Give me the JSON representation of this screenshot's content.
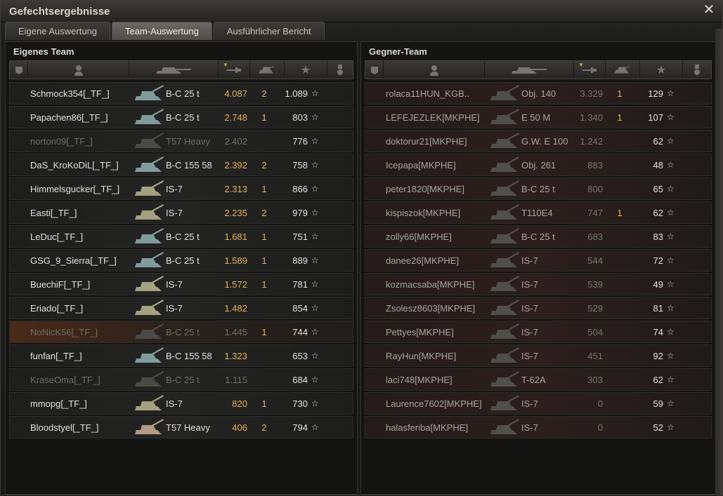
{
  "window": {
    "title": "Gefechtsergebnisse",
    "close_glyph": "✕"
  },
  "tabs": [
    {
      "label": "Eigene Auswertung",
      "active": false
    },
    {
      "label": "Team-Auswertung",
      "active": true
    },
    {
      "label": "Ausführlicher Bericht",
      "active": false
    }
  ],
  "colors": {
    "damage": "#e4b25a",
    "self_row": "#4a2a18",
    "enemy_row": "#2d1f1e",
    "active_tab": "#6a6963"
  },
  "own_team": {
    "title": "Eigenes Team",
    "header_icons": [
      "squad-icon",
      "player-icon",
      "tank-icon",
      "damage-icon",
      "kills-icon",
      "xp-star-icon",
      "medal-icon"
    ],
    "sorted_column": "damage",
    "rows": [
      {
        "player": "Schmock354[_TF_]",
        "vehicle": "B-C 25 t",
        "damage": "4.087",
        "kills": "2",
        "xp": "1.089",
        "alive": true,
        "tank_color": "#7f9c9a"
      },
      {
        "player": "Papachen86[_TF_]",
        "vehicle": "B-C 25 t",
        "damage": "2.748",
        "kills": "1",
        "xp": "803",
        "alive": true,
        "tank_color": "#7f9c9a"
      },
      {
        "player": "norton09[_TF_]",
        "vehicle": "T57 Heavy",
        "damage": "2.402",
        "kills": "",
        "xp": "776",
        "alive": false,
        "tank_color": "#4a4a46"
      },
      {
        "player": "DaS_KroKoDiL[_TF_]",
        "vehicle": "B-C 155 58",
        "damage": "2.392",
        "kills": "2",
        "xp": "758",
        "alive": true,
        "tank_color": "#7f9c9a"
      },
      {
        "player": "Himmelsgucker[_TF_]",
        "vehicle": "IS-7",
        "damage": "2.313",
        "kills": "1",
        "xp": "866",
        "alive": true,
        "tank_color": "#a4a180"
      },
      {
        "player": "Easti[_TF_]",
        "vehicle": "IS-7",
        "damage": "2.235",
        "kills": "2",
        "xp": "979",
        "alive": true,
        "tank_color": "#a4a180"
      },
      {
        "player": "LeDuc[_TF_]",
        "vehicle": "B-C 25 t",
        "damage": "1.681",
        "kills": "1",
        "xp": "751",
        "alive": true,
        "tank_color": "#7f9c9a"
      },
      {
        "player": "GSG_9_Sierra[_TF_]",
        "vehicle": "B-C 25 t",
        "damage": "1.589",
        "kills": "1",
        "xp": "889",
        "alive": true,
        "tank_color": "#7f9c9a"
      },
      {
        "player": "BuechiF[_TF_]",
        "vehicle": "IS-7",
        "damage": "1.572",
        "kills": "1",
        "xp": "781",
        "alive": true,
        "tank_color": "#a4a180"
      },
      {
        "player": "Eriado[_TF_]",
        "vehicle": "IS-7",
        "damage": "1.482",
        "kills": "",
        "xp": "854",
        "alive": true,
        "tank_color": "#a4a180"
      },
      {
        "player": "NoNicK56[_TF_]",
        "vehicle": "B-C 25 t",
        "damage": "1.445",
        "kills": "1",
        "xp": "744",
        "alive": false,
        "self": true,
        "tank_color": "#4a4a46"
      },
      {
        "player": "funfan[_TF_]",
        "vehicle": "B-C 155 58",
        "damage": "1.323",
        "kills": "",
        "xp": "653",
        "alive": true,
        "tank_color": "#7f9c9a"
      },
      {
        "player": "KraseOma[_TF_]",
        "vehicle": "B-C 25 t",
        "damage": "1.115",
        "kills": "",
        "xp": "684",
        "alive": false,
        "tank_color": "#4a4a46"
      },
      {
        "player": "mmopg[_TF_]",
        "vehicle": "IS-7",
        "damage": "820",
        "kills": "1",
        "xp": "730",
        "alive": true,
        "tank_color": "#a4a180"
      },
      {
        "player": "Bloodstyel[_TF_]",
        "vehicle": "T57 Heavy",
        "damage": "406",
        "kills": "2",
        "xp": "794",
        "alive": true,
        "tank_color": "#b49a86"
      }
    ]
  },
  "enemy_team": {
    "title": "Gegner-Team",
    "header_icons": [
      "squad-icon",
      "player-icon",
      "tank-icon",
      "damage-icon",
      "kills-icon",
      "xp-star-icon",
      "medal-icon"
    ],
    "sorted_column": "damage",
    "rows": [
      {
        "player": "rolaca11HUN_KGB..",
        "vehicle": "Obj. 140",
        "damage": "3.329",
        "kills": "1",
        "xp": "129",
        "tank_color": "#4f4f4b"
      },
      {
        "player": "LEFEJEZLEK[MKPHE]",
        "vehicle": "E 50 M",
        "damage": "1.340",
        "kills": "1",
        "xp": "107",
        "tank_color": "#4f4f4b"
      },
      {
        "player": "doktorur21[MKPHE]",
        "vehicle": "G.W. E 100",
        "damage": "1.242",
        "kills": "",
        "xp": "62",
        "tank_color": "#4f4f4b"
      },
      {
        "player": "Icepapa[MKPHE]",
        "vehicle": "Obj. 261",
        "damage": "883",
        "kills": "",
        "xp": "48",
        "tank_color": "#4f4f4b"
      },
      {
        "player": "peter1820[MKPHE]",
        "vehicle": "B-C 25 t",
        "damage": "800",
        "kills": "",
        "xp": "65",
        "tank_color": "#4f4f4b"
      },
      {
        "player": "kispiszok[MKPHE]",
        "vehicle": "T110E4",
        "damage": "747",
        "kills": "1",
        "xp": "62",
        "tank_color": "#4f4f4b"
      },
      {
        "player": "zolly66[MKPHE]",
        "vehicle": "B-C 25 t",
        "damage": "683",
        "kills": "",
        "xp": "83",
        "tank_color": "#4f4f4b"
      },
      {
        "player": "danee26[MKPHE]",
        "vehicle": "IS-7",
        "damage": "544",
        "kills": "",
        "xp": "72",
        "tank_color": "#4f4f4b"
      },
      {
        "player": "kozmacsaba[MKPHE]",
        "vehicle": "IS-7",
        "damage": "539",
        "kills": "",
        "xp": "49",
        "tank_color": "#4f4f4b"
      },
      {
        "player": "Zsolesz8603[MKPHE]",
        "vehicle": "IS-7",
        "damage": "529",
        "kills": "",
        "xp": "81",
        "tank_color": "#4f4f4b"
      },
      {
        "player": "Pettyes[MKPHE]",
        "vehicle": "IS-7",
        "damage": "504",
        "kills": "",
        "xp": "74",
        "tank_color": "#4f4f4b"
      },
      {
        "player": "RayHun[MKPHE]",
        "vehicle": "IS-7",
        "damage": "451",
        "kills": "",
        "xp": "92",
        "tank_color": "#4f4f4b"
      },
      {
        "player": "laci748[MKPHE]",
        "vehicle": "T-62A",
        "damage": "303",
        "kills": "",
        "xp": "62",
        "tank_color": "#4f4f4b"
      },
      {
        "player": "Laurence7602[MKPHE]",
        "vehicle": "IS-7",
        "damage": "0",
        "kills": "",
        "xp": "59",
        "tank_color": "#4f4f4b"
      },
      {
        "player": "halasferiba[MKPHE]",
        "vehicle": "IS-7",
        "damage": "0",
        "kills": "",
        "xp": "52",
        "tank_color": "#4f4f4b"
      }
    ]
  },
  "star_glyph": "☆"
}
